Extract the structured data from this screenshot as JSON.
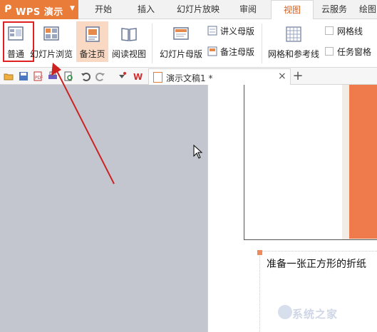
{
  "app": {
    "name": "WPS 演示",
    "accent": "#ea7c3a",
    "active_tab_color": "#d55c1d"
  },
  "tabs": [
    {
      "label": "开始",
      "active": false
    },
    {
      "label": "插入",
      "active": false
    },
    {
      "label": "幻灯片放映",
      "active": false
    },
    {
      "label": "审阅",
      "active": false
    },
    {
      "label": "视图",
      "active": true
    },
    {
      "label": "云服务",
      "active": false
    },
    {
      "label": "绘图",
      "active": false
    }
  ],
  "ribbon": {
    "normal": "普通",
    "slide_sorter": "幻灯片浏览",
    "notes_page": "备注页",
    "reading_view": "阅读视图",
    "slide_master": "幻灯片母版",
    "handout_master": "讲义母版",
    "notes_master": "备注母版",
    "grid_guides": "网格和参考线",
    "gridlines": "网格线",
    "task_pane": "任务窗格"
  },
  "document": {
    "tab_title": "演示文稿1 *",
    "notes_text": "准备一张正方形的折纸"
  },
  "annotation": {
    "highlight_color": "#e02020",
    "arrow_color": "#cc2222"
  },
  "watermark": "系统之家"
}
